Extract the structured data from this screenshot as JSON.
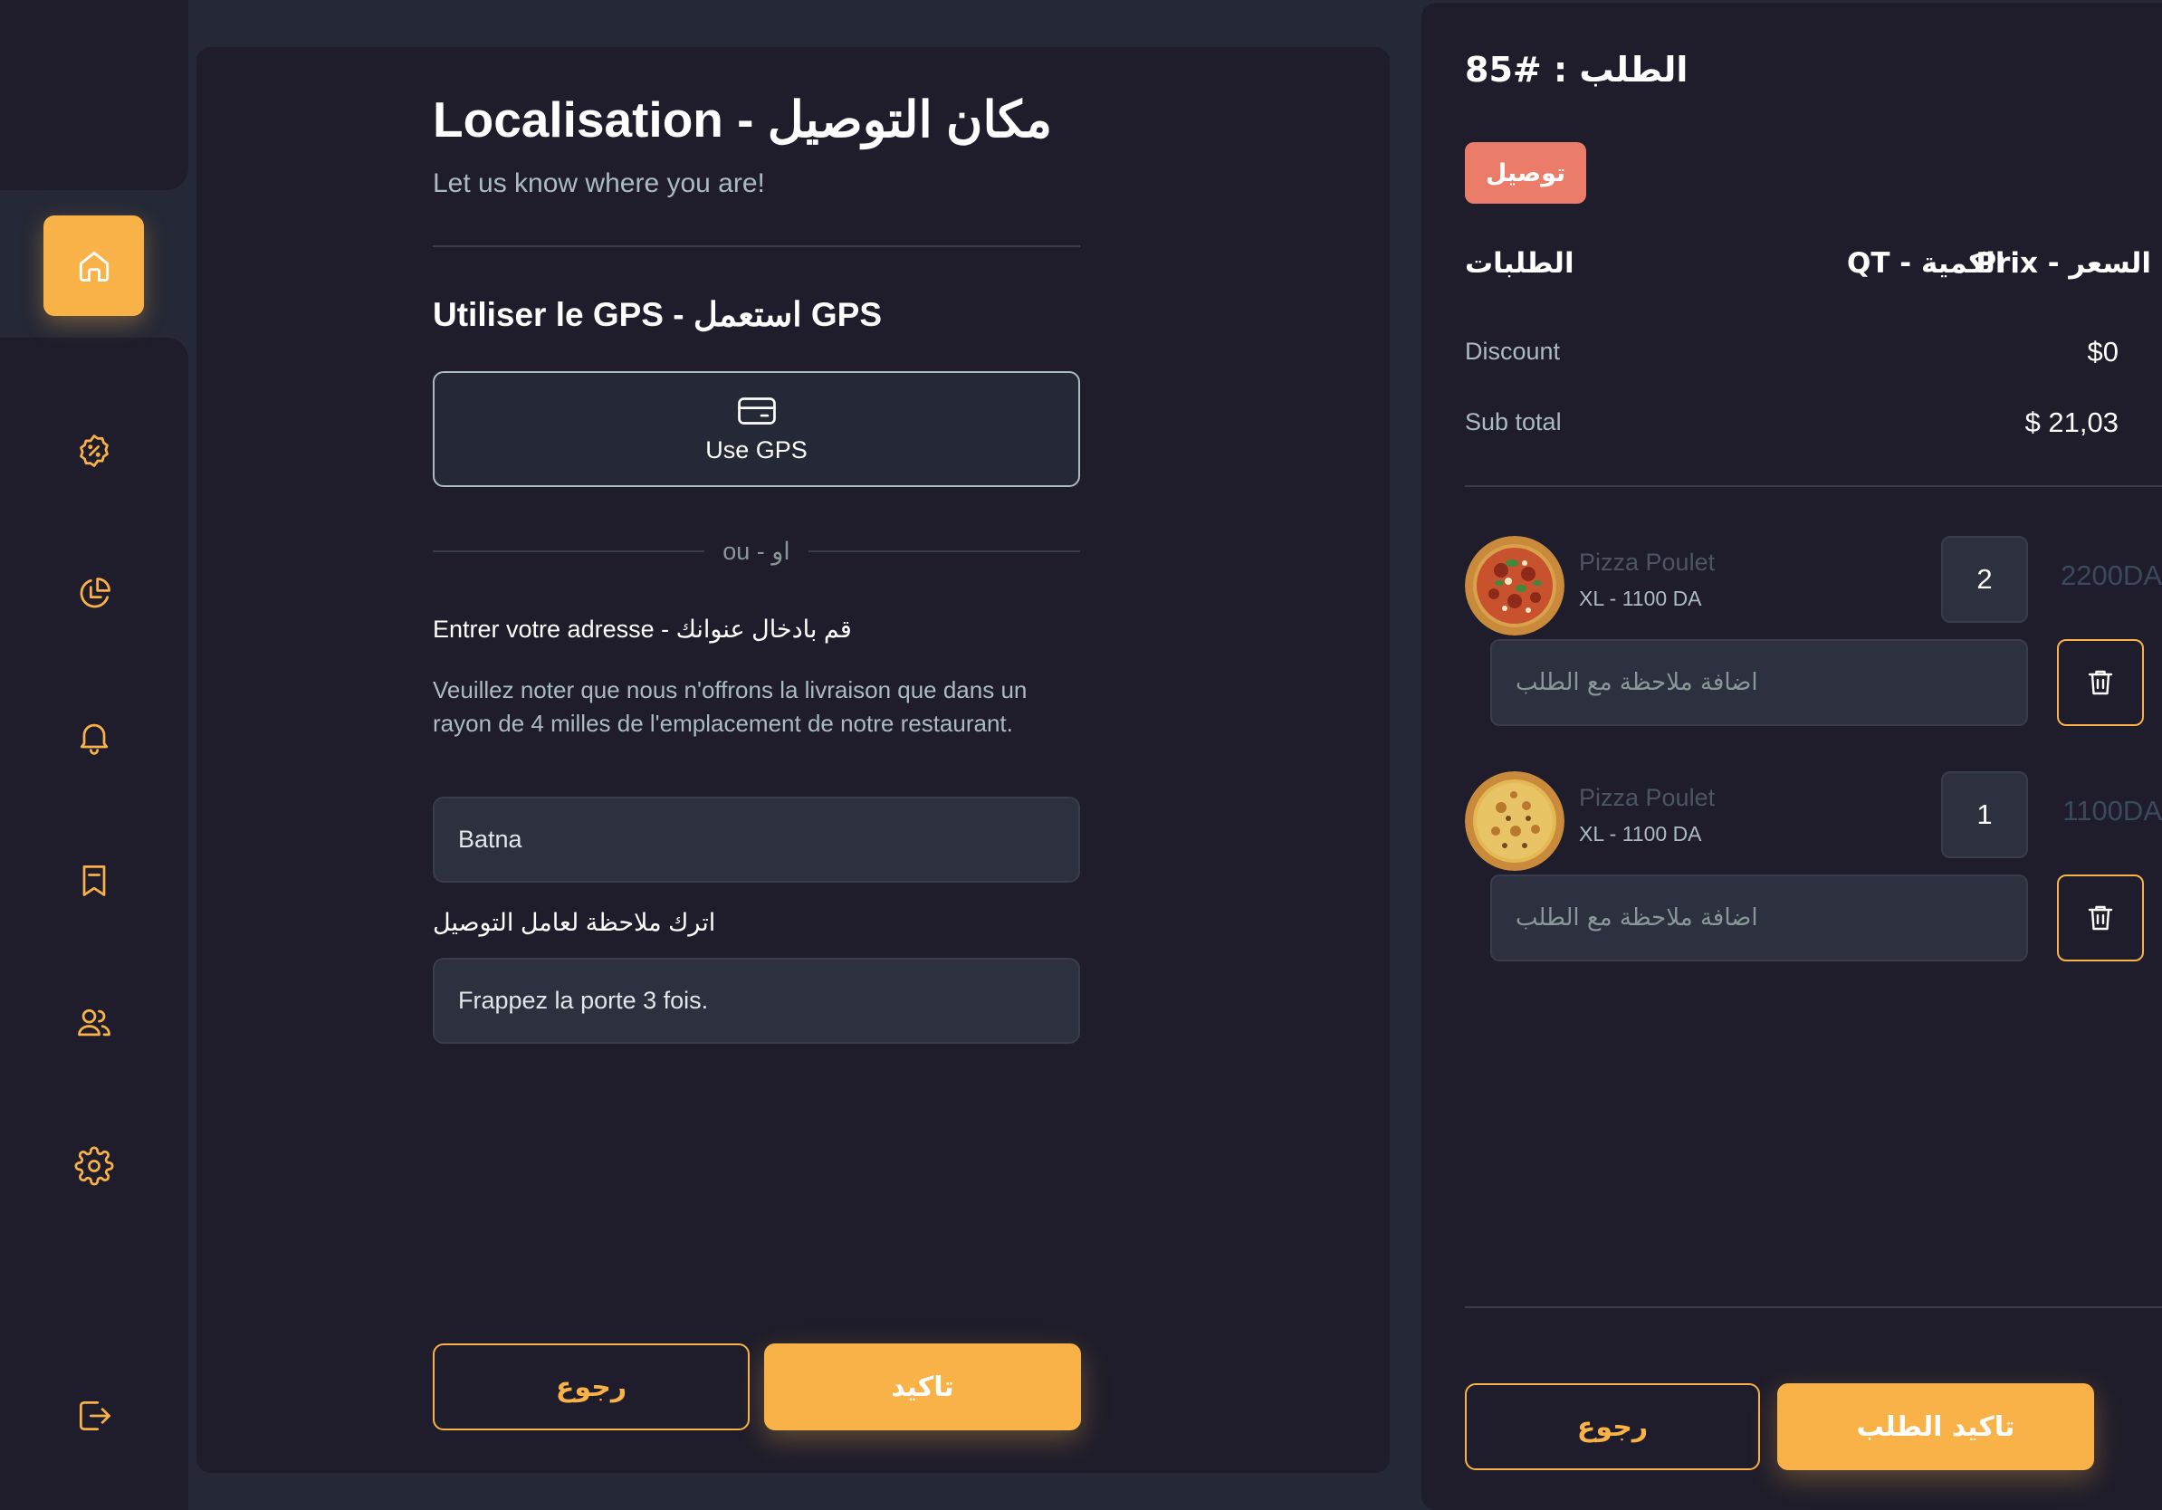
{
  "sidebar": {
    "items": [
      {
        "name": "home-icon",
        "label": "Home"
      },
      {
        "name": "discount-icon",
        "label": "Discount"
      },
      {
        "name": "pie-chart-icon",
        "label": "Dashboard"
      },
      {
        "name": "bell-icon",
        "label": "Notifications"
      },
      {
        "name": "bookmark-icon",
        "label": "Orders"
      },
      {
        "name": "users-icon",
        "label": "Users"
      },
      {
        "name": "gear-icon",
        "label": "Settings"
      },
      {
        "name": "logout-icon",
        "label": "Logout"
      }
    ],
    "active_index": 0
  },
  "location": {
    "title": "Localisation - مكان التوصيل",
    "subtitle": "Let us know where you are!",
    "gps_title": "Utiliser le GPS - استعمل GPS",
    "gps_button_label": "Use GPS",
    "or_text": "ou - او",
    "address_label": "Entrer votre adresse - قم بادخال عنوانك",
    "notice": "Veuillez noter que nous n'offrons la livraison que dans un rayon de 4 milles de l'emplacement de notre restaurant.",
    "address_value": "Batna",
    "note_label": "اترك ملاحظة لعامل التوصيل",
    "note_value": "Frappez la porte 3 fois.",
    "back_label": "رجوع",
    "confirm_label": "تاكيد"
  },
  "order": {
    "title": "الطلب : #85",
    "badge": "توصيل",
    "header_items": "الطلبات",
    "header_qty": "QT - الكمية",
    "header_price": "Prix - السعر",
    "discount_label": "Discount",
    "discount_value": "$0",
    "subtotal_label": "Sub total",
    "subtotal_value": "$ 21,03",
    "items": [
      {
        "name": "Pizza Poulet",
        "size": "XL - 1100 DA",
        "qty": "2",
        "price": "2200DA",
        "note_placeholder": "اضافة ملاحظة مع الطلب"
      },
      {
        "name": "Pizza Poulet",
        "size": "XL - 1100 DA",
        "qty": "1",
        "price": "1100DA",
        "note_placeholder": "اضافة ملاحظة مع الطلب"
      }
    ],
    "back_label": "رجوع",
    "confirm_label": "تاكيد الطلب"
  },
  "colors": {
    "accent": "#f9b248",
    "badge": "#ea7c69",
    "panel": "#1f1d2b",
    "background": "#252836"
  }
}
